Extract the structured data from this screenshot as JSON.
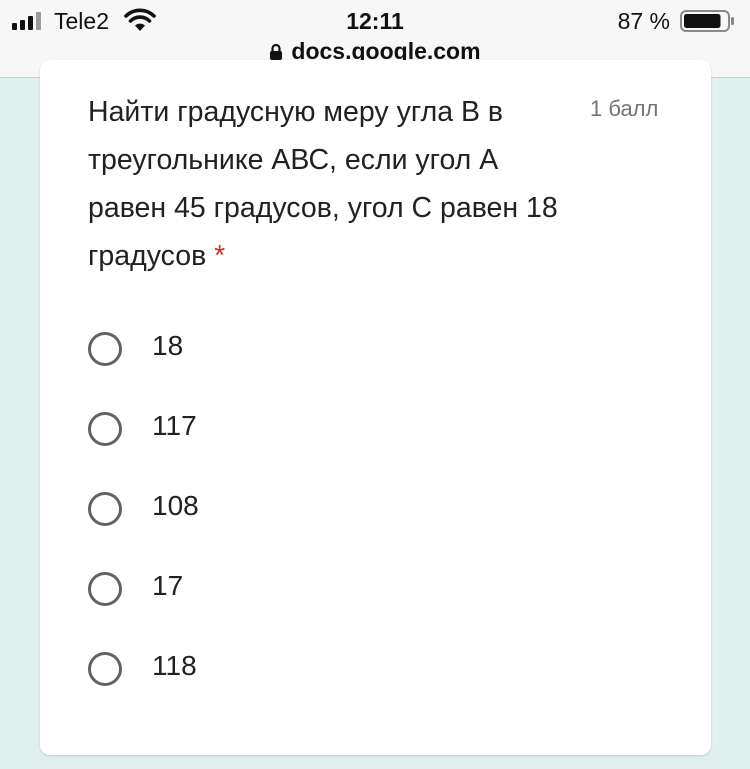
{
  "status_bar": {
    "carrier": "Tele2",
    "time": "12:11",
    "battery_percent": "87 %",
    "battery_level": 0.87,
    "signal_icon": "cellular-signal-icon",
    "wifi_icon": "wifi-icon",
    "battery_icon": "battery-icon"
  },
  "browser": {
    "url": "docs.google.com",
    "lock_icon": "lock-icon"
  },
  "question": {
    "text": "Найти градусную меру угла В в треугольнике АВС, если угол А равен 45 градусов, угол С равен 18 градусов",
    "required_marker": "*",
    "points": "1 балл",
    "required_color": "#d93025"
  },
  "options": [
    {
      "label": "18",
      "selected": false
    },
    {
      "label": "117",
      "selected": false
    },
    {
      "label": "108",
      "selected": false
    },
    {
      "label": "17",
      "selected": false
    },
    {
      "label": "118",
      "selected": false
    }
  ]
}
